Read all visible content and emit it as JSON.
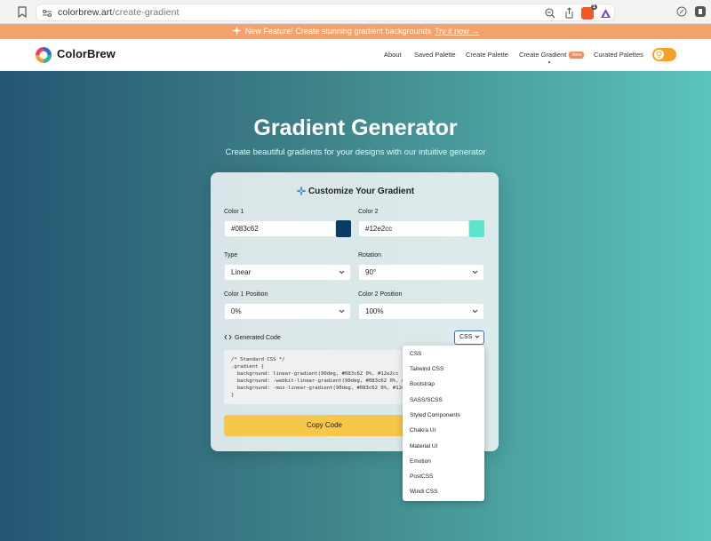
{
  "browser": {
    "url_host": "colorbrew.art",
    "url_path": "/create-gradient",
    "brave_badge": "1"
  },
  "banner": {
    "text": "New Feature! Create stunning gradient backgrounds",
    "link": "Try it now →"
  },
  "nav": {
    "brand": "ColorBrew",
    "links": [
      "About",
      "Saved Palette",
      "Create Palette",
      "Create Gradient",
      "Curated Palettes"
    ],
    "new_badge": "New"
  },
  "hero": {
    "title": "Gradient Generator",
    "subtitle": "Create beautiful gradients for your designs with our intuitive generator"
  },
  "card": {
    "title": "Customize Your Gradient",
    "color1_label": "Color 1",
    "color1_value": "#083c62",
    "color2_label": "Color 2",
    "color2_value": "#12e2cc",
    "type_label": "Type",
    "type_value": "Linear",
    "rotation_label": "Rotation",
    "rotation_value": "90°",
    "pos1_label": "Color 1 Position",
    "pos1_value": "0%",
    "pos2_label": "Color 2 Position",
    "pos2_value": "100%",
    "code_label": "Generated Code",
    "format_value": "CSS",
    "code_lines": [
      "/* Standard CSS */",
      ".gradient {",
      "  background: linear-gradient(90deg, #083c62 0%, #12e2cc 100%);",
      "  background: -webkit-linear-gradient(90deg, #083c62 0%, #12e2cc 100%);",
      "  background: -moz-linear-gradient(90deg, #083c62 0%, #12e2cc 100%);",
      "}"
    ],
    "copy_button": "Copy Code"
  },
  "format_options": [
    "CSS",
    "Tailwind CSS",
    "Bootstrap",
    "SASS/SCSS",
    "Styled Components",
    "Chakra UI",
    "Material UI",
    "Emotion",
    "PostCSS",
    "Windi CSS"
  ],
  "colors": {
    "banner": "#f5a36a",
    "accent": "#f6c74a",
    "toggle": "#f5a026",
    "gradient_left": "#245673",
    "gradient_right": "#5bc4bc"
  }
}
